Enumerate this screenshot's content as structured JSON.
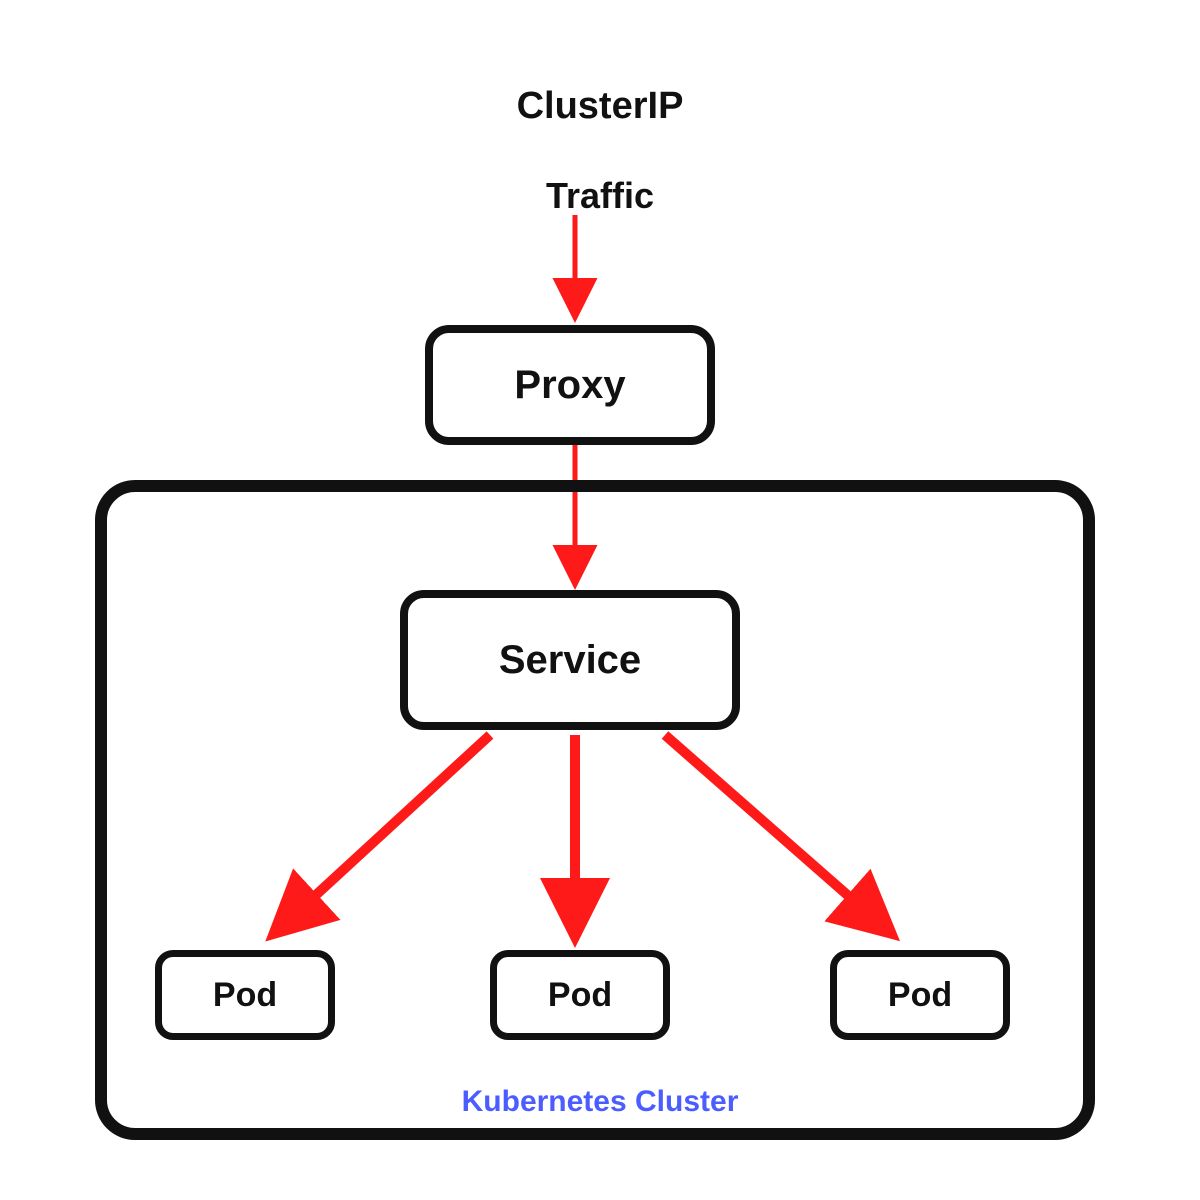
{
  "title": "ClusterIP",
  "trafficLabel": "Traffic",
  "proxyLabel": "Proxy",
  "serviceLabel": "Service",
  "pods": [
    "Pod",
    "Pod",
    "Pod"
  ],
  "clusterLabel": "Kubernetes Cluster",
  "colors": {
    "arrow": "#ff1a1a",
    "clusterText": "#4b5dff",
    "border": "#111111"
  }
}
